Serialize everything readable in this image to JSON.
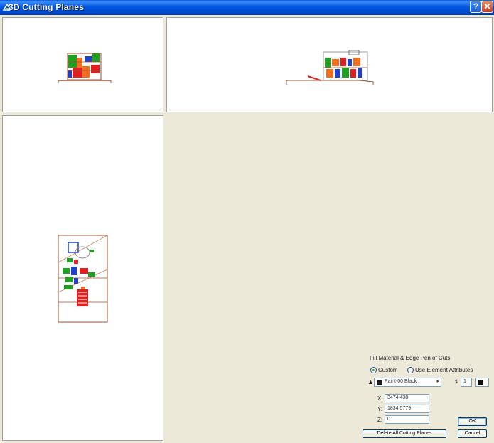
{
  "window": {
    "title": "3D Cutting Planes",
    "help_glyph": "?",
    "close_glyph": "✕"
  },
  "views": {
    "top_left": "front-elevation",
    "top_right": "side-elevation",
    "bottom_left": "plan-view"
  },
  "settings": {
    "heading": "Fill Material & Edge Pen of Cuts",
    "radio_custom_label": "Custom",
    "radio_element_label": "Use Element Attributes",
    "selected_option": "Custom",
    "material_value": "Paint-00 Black",
    "pen_number": "1",
    "x_label": "X:",
    "x_value": "3474.438",
    "y_label": "Y:",
    "y_value": "1834.5779",
    "z_label": "Z:",
    "z_value": "0",
    "ok_label": "OK",
    "cancel_label": "Cancel",
    "delete_label": "Delete All Cutting Planes"
  },
  "colors": {
    "title_bar": "#0058e6",
    "dialog_bg": "#ece9d8",
    "drawing_brown": "#a0522d",
    "drawing_red": "#e02020",
    "drawing_green": "#20a020",
    "drawing_blue": "#2040d0",
    "drawing_orange": "#f07020"
  }
}
